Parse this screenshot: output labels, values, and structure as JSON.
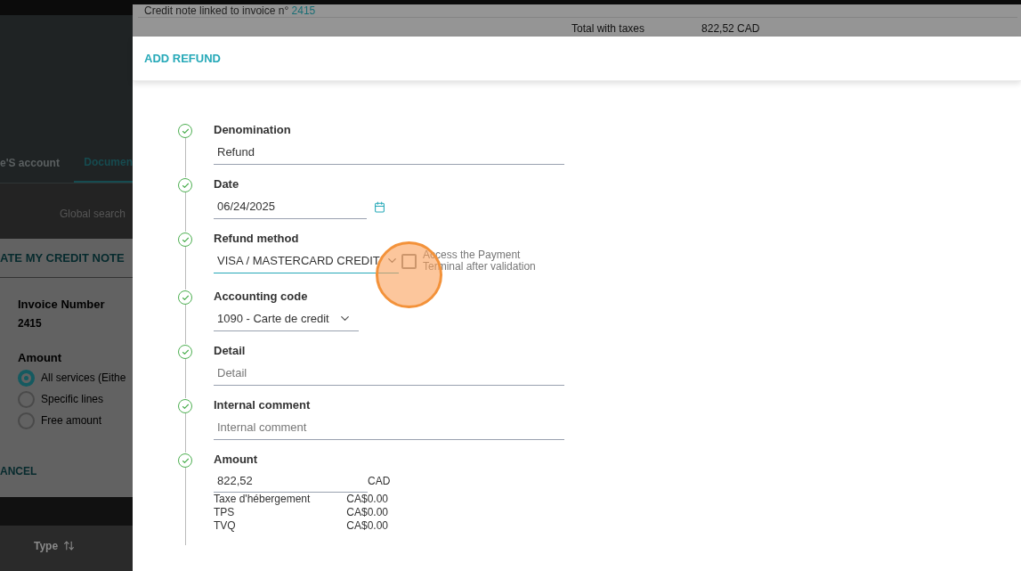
{
  "background": {
    "tabs": [
      {
        "label": "e'S account",
        "selected": false
      },
      {
        "label": "Documen",
        "selected": true
      }
    ],
    "search_label": "Global search",
    "panel": {
      "title": "ATE MY CREDIT NOTE",
      "invoice_label": "Invoice Number",
      "invoice_number": "2415",
      "amount_label": "Amount",
      "options": [
        {
          "label": "All services (Eithe",
          "selected": true
        },
        {
          "label": "Specific lines",
          "selected": false
        },
        {
          "label": "Free amount",
          "selected": false
        }
      ],
      "cancel": "ANCEL"
    },
    "table_header": {
      "label": "Type"
    }
  },
  "credit_note": {
    "text": "Credit note linked to invoice n°",
    "invoice": "2415",
    "total_label": "Total with taxes",
    "total_value": "822,52 CAD"
  },
  "modal": {
    "title": "ADD REFUND",
    "steps": [
      {
        "kind": "text",
        "label": "Denomination",
        "value": "Refund",
        "complete": true
      },
      {
        "kind": "date",
        "label": "Date",
        "value": "06/24/2025",
        "complete": true
      },
      {
        "kind": "select",
        "label": "Refund method",
        "value": "VISA / MASTERCARD CREDIT",
        "focused": true,
        "complete": true,
        "checkbox": {
          "label": "Access the Payment Terminal after validation",
          "checked": false
        }
      },
      {
        "kind": "select_short",
        "label": "Accounting code",
        "value": "1090 - Carte de credit",
        "complete": true
      },
      {
        "kind": "text",
        "label": "Detail",
        "placeholder": "Detail",
        "complete": true
      },
      {
        "kind": "text",
        "label": "Internal comment",
        "placeholder": "Internal comment",
        "complete": true
      },
      {
        "kind": "amount",
        "label": "Amount",
        "value": "822,52",
        "currency": "CAD",
        "complete": true,
        "taxes": [
          {
            "name": "Taxe d'hébergement",
            "amount": "CA$0.00"
          },
          {
            "name": "TPS",
            "amount": "CA$0.00"
          },
          {
            "name": "TVQ",
            "amount": "CA$0.00"
          }
        ]
      }
    ]
  }
}
